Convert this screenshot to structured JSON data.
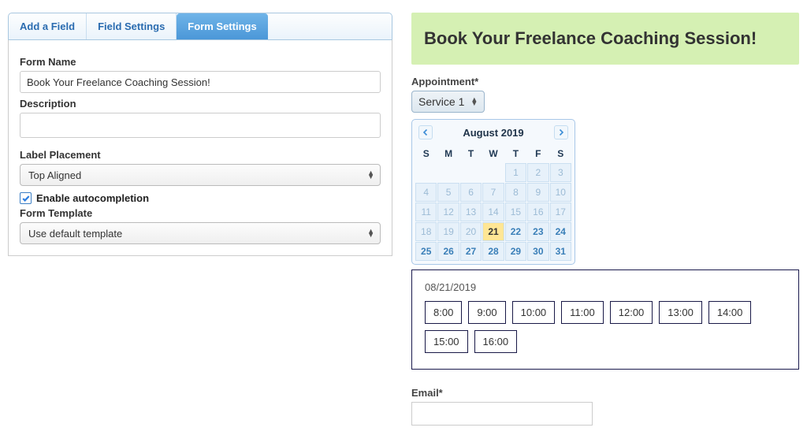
{
  "tabs": {
    "add_field": "Add a Field",
    "field_settings": "Field Settings",
    "form_settings": "Form Settings"
  },
  "left_panel": {
    "form_name_label": "Form Name",
    "form_name_value": "Book Your Freelance Coaching Session!",
    "description_label": "Description",
    "description_value": "",
    "label_placement_label": "Label Placement",
    "label_placement_value": "Top Aligned",
    "enable_autocompletion_label": "Enable autocompletion",
    "enable_autocompletion_checked": true,
    "form_template_label": "Form Template",
    "form_template_value": "Use default template"
  },
  "preview": {
    "title": "Book Your Freelance Coaching Session!",
    "appointment_label": "Appointment*",
    "service_value": "Service 1",
    "calendar": {
      "month_title": "August 2019",
      "dows": [
        "S",
        "M",
        "T",
        "W",
        "T",
        "F",
        "S"
      ],
      "weeks": [
        [
          null,
          null,
          null,
          null,
          {
            "d": 1,
            "muted": true
          },
          {
            "d": 2,
            "muted": true
          },
          {
            "d": 3,
            "muted": true
          }
        ],
        [
          {
            "d": 4,
            "muted": true
          },
          {
            "d": 5,
            "muted": true
          },
          {
            "d": 6,
            "muted": true
          },
          {
            "d": 7,
            "muted": true
          },
          {
            "d": 8,
            "muted": true
          },
          {
            "d": 9,
            "muted": true
          },
          {
            "d": 10,
            "muted": true
          }
        ],
        [
          {
            "d": 11,
            "muted": true
          },
          {
            "d": 12,
            "muted": true
          },
          {
            "d": 13,
            "muted": true
          },
          {
            "d": 14,
            "muted": true
          },
          {
            "d": 15,
            "muted": true
          },
          {
            "d": 16,
            "muted": true
          },
          {
            "d": 17,
            "muted": true
          }
        ],
        [
          {
            "d": 18,
            "muted": true
          },
          {
            "d": 19,
            "muted": true
          },
          {
            "d": 20,
            "muted": true
          },
          {
            "d": 21,
            "selected": true
          },
          {
            "d": 22,
            "bold": true
          },
          {
            "d": 23,
            "bold": true
          },
          {
            "d": 24,
            "bold": true
          }
        ],
        [
          {
            "d": 25,
            "bold": true
          },
          {
            "d": 26,
            "bold": true
          },
          {
            "d": 27,
            "bold": true
          },
          {
            "d": 28,
            "bold": true
          },
          {
            "d": 29,
            "bold": true
          },
          {
            "d": 30,
            "bold": true
          },
          {
            "d": 31,
            "bold": true
          }
        ]
      ]
    },
    "slot_date": "08/21/2019",
    "slots": [
      "8:00",
      "9:00",
      "10:00",
      "11:00",
      "12:00",
      "13:00",
      "14:00",
      "15:00",
      "16:00"
    ],
    "email_label": "Email*"
  }
}
